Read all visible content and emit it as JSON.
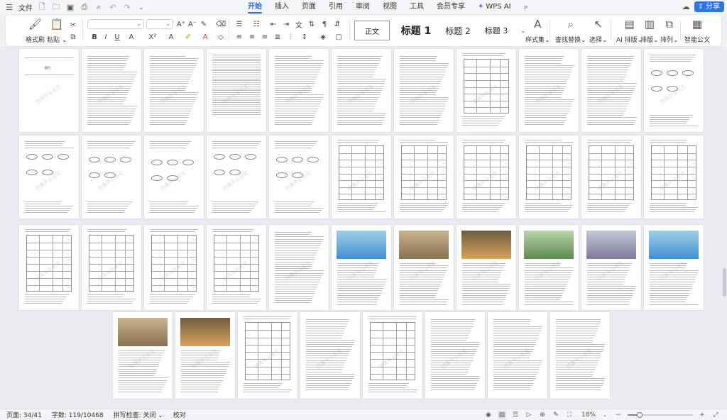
{
  "menubar": {
    "file_label": "文件",
    "tabs": [
      {
        "label": "开始",
        "active": true
      },
      {
        "label": "插入",
        "active": false
      },
      {
        "label": "页面",
        "active": false
      },
      {
        "label": "引用",
        "active": false
      },
      {
        "label": "审阅",
        "active": false
      },
      {
        "label": "视图",
        "active": false
      },
      {
        "label": "工具",
        "active": false
      },
      {
        "label": "会员专享",
        "active": false
      },
      {
        "label": "WPS AI",
        "active": false
      }
    ],
    "share_label": "分享"
  },
  "ribbon": {
    "format_painter": "格式刷",
    "paste": "粘贴",
    "styles": {
      "normal": "正文",
      "heading1": "标题 1",
      "heading2": "标题 2",
      "heading3": "标题 3"
    },
    "style_set": "样式集",
    "find_replace": "查找替换",
    "select": "选择",
    "ai_layout": "AI 排版",
    "layout": "排版",
    "arrange": "排列",
    "smart_doc": "智能公文",
    "font_buttons": [
      "B",
      "I",
      "U",
      "A",
      "X²",
      "A",
      "A"
    ]
  },
  "document": {
    "cover_title": "题目：",
    "watermark": "仿真毕业论文"
  },
  "statusbar": {
    "page": "页面: 34/41",
    "words": "字数: 119/10468",
    "spellcheck": "拼写检查: 关闭",
    "proofread": "校对",
    "zoom": "18%",
    "zoom_fraction": 0.18
  },
  "colors": {
    "accent": "#1e6bdb",
    "share_bg": "#2d74e8",
    "highlight_yellow": "#f5d60b",
    "font_red": "#e23c32"
  }
}
